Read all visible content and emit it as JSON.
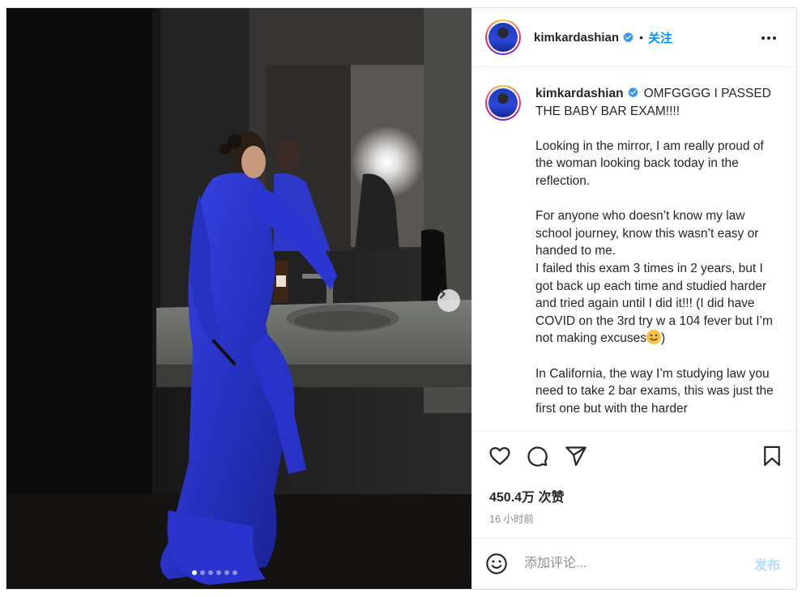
{
  "post": {
    "username": "kimkardashian",
    "follow_label": "关注",
    "separator": "•",
    "caption_lines": [
      "OMFGGGG I PASSED THE BABY BAR EXAM!!!!",
      "",
      "Looking in the mirror, I am really proud of the woman looking back today in the reflection.",
      "",
      "For anyone who doesn’t know my law school journey, know this wasn’t easy or handed to me.",
      "I failed this exam 3 times in 2 years, but I got back up each time and studied harder and tried again until I did it!!! (I did have COVID on the 3rd try w a 104 fever but I’m not making excuses",
      ")",
      "",
      "In California, the way I’m studying law you need to take 2 bar exams, this was just the first one but with the harder"
    ],
    "caption_intro": "OMFGGGG I PASSED THE BABY BAR EXAM!!!!",
    "caption_p1": "Looking in the mirror, I am really proud of the woman looking back today in the reflection.",
    "caption_p2a": "For anyone who doesn’t know my law school journey, know this wasn’t easy or handed to me.",
    "caption_p2b": "I failed this exam 3 times in 2 years, but I got back up each time and studied harder and tried again until I did it!!! (I did have COVID on the 3rd try w a 104 fever but I’m not making excuses",
    "caption_p2c": ")",
    "caption_p3": "In California, the way I’m studying law you need to take 2 bar exams, this was just the first one but with the harder",
    "likes": "450.4万 次赞",
    "time": "16 小时前",
    "comment_placeholder": "添加评论...",
    "post_label": "发布",
    "carousel": {
      "total": 6,
      "current": 1
    }
  },
  "icons": {
    "verified": "verified-badge-icon",
    "more": "more-options-icon",
    "like": "heart-icon",
    "comment": "comment-bubble-icon",
    "share": "paper-plane-icon",
    "save": "bookmark-icon",
    "emoji": "emoji-smile-icon",
    "next": "chevron-right-icon"
  },
  "colors": {
    "accent": "#0095f6",
    "dress": "#2f3ad6",
    "muted": "#8e8e8e"
  }
}
